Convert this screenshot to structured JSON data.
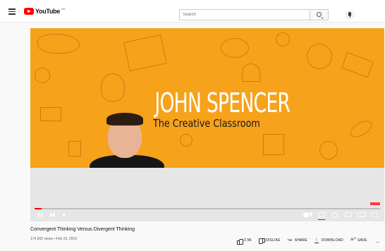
{
  "header": {
    "logo_text": "YouTube",
    "logo_region": "DE",
    "search": {
      "placeholder": "Search",
      "value": ""
    },
    "icons": [
      "menu-icon",
      "youtube-logo",
      "search-icon",
      "mic-icon"
    ]
  },
  "video": {
    "banner": {
      "title": "JOHN SPENCER",
      "subtitle": "The Creative Classroom"
    },
    "progress": 0.02,
    "controls": [
      "play-pause-icon",
      "next-icon",
      "volume-icon",
      "autoplay-toggle",
      "captions-icon",
      "settings-icon",
      "miniplayer-icon",
      "theater-icon",
      "fullscreen-icon"
    ]
  },
  "info": {
    "title": "Convergent Thinking Versus Divergent Thinking",
    "meta": "174,932 views • Feb 19, 2019",
    "actions": {
      "like": "2.5K",
      "dislike": "DISLIKE",
      "share": "SHARE",
      "download": "DOWNLOAD",
      "save": "SAVE",
      "more": "..."
    }
  },
  "colors": {
    "brand_red": "#ff0000",
    "banner_orange": "#f7a21b"
  }
}
